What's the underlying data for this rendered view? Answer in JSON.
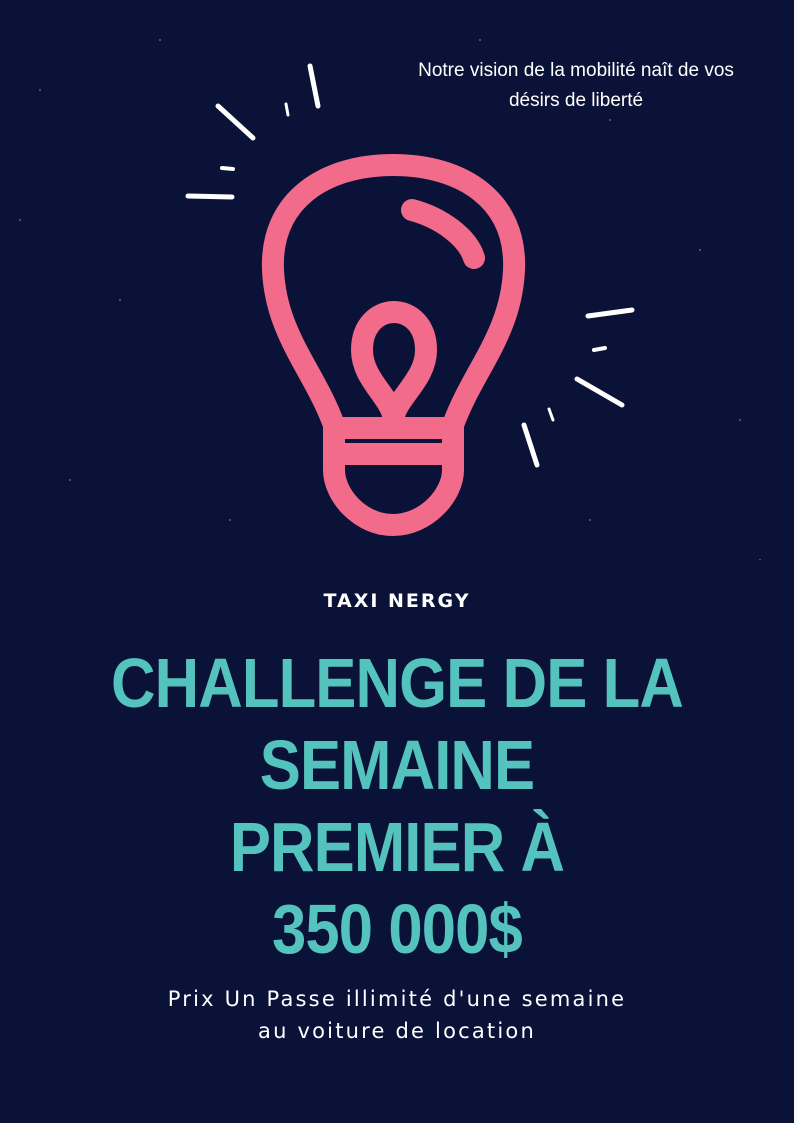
{
  "tagline": {
    "line1": "Notre vision de la mobilité naît de vos",
    "line2": "désirs de liberté"
  },
  "illustration": {
    "icon": "lightbulb-icon",
    "bulb_color": "#f26b8a",
    "spark_color": "#ffffff"
  },
  "brand": "TAXI NERGY",
  "headline": {
    "line1": "CHALLENGE DE LA",
    "line2": "SEMAINE",
    "line3": "PREMIER À",
    "line4": "350 000$"
  },
  "prize": {
    "line1": "Prix Un Passe illimité d'une semaine",
    "line2": "au voiture de location"
  },
  "colors": {
    "background": "#0b1238",
    "accent": "#55c3bd",
    "bulb": "#f26b8a",
    "text": "#ffffff"
  }
}
